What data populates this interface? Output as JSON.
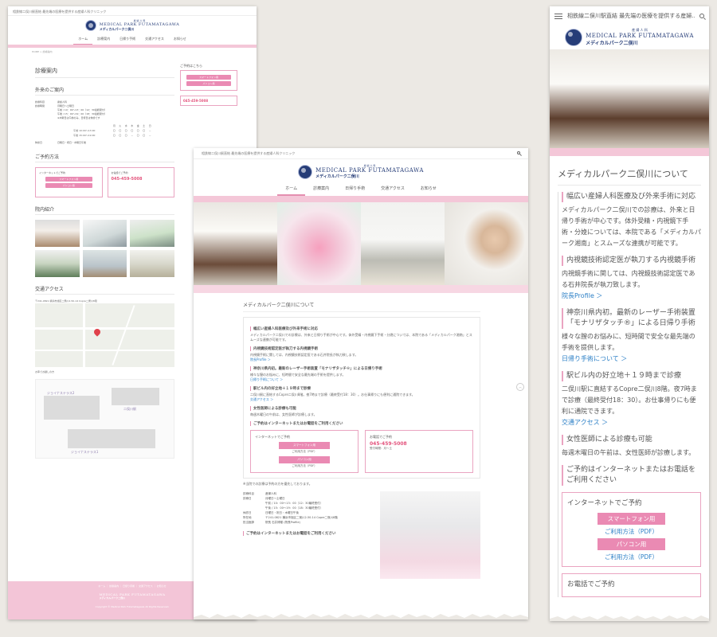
{
  "left": {
    "topbar": "相鉄線二俣川駅直結 最先端の医療を提供する産婦人科クリニック",
    "logo": {
      "kana": "産 婦 人 科",
      "en": "MEDICAL PARK FUTAMATAGAWA",
      "jp": "メディカルパーク二俣川"
    },
    "nav": [
      "ホーム",
      "診療案内",
      "日帰り手術",
      "交通アクセス",
      "お知らせ"
    ],
    "crumb": "HOME > 診療案内",
    "page_title": "診療案内",
    "outpatient_title": "外来のご案内",
    "rows": [
      {
        "k": "診療科目",
        "v": "産婦人科"
      },
      {
        "k": "診療時間",
        "v": "月曜日～土曜日"
      },
      {
        "k": "",
        "v": "午前 / 10：00～13：00（12：30最終受付）"
      },
      {
        "k": "",
        "v": "午後 / 15：00～19：00（18：30最終受付）"
      },
      {
        "k": "",
        "v": "※木曜日は午前のみ、日祝日は休診です"
      }
    ],
    "sched_head": [
      "",
      "月",
      "火",
      "水",
      "木",
      "金",
      "土",
      "日"
    ],
    "sched_am": [
      "午前 10:00～13:00",
      "〇",
      "〇",
      "〇",
      "〇",
      "〇",
      "〇",
      "－"
    ],
    "sched_pm": [
      "午後 15:00～19:00",
      "〇",
      "〇",
      "〇",
      "－",
      "〇",
      "〇",
      "－"
    ],
    "holiday": {
      "k": "休診日",
      "v": "日曜日・祝日・木曜日午後"
    },
    "reserve_title": "ご予約方法",
    "reserve_net": "インターネットでご予約",
    "btn_sp": "スマートフォン用",
    "btn_pc": "パソコン用",
    "reserve_tel": "お電話でご予約",
    "tel": "045-459-5008",
    "interior_title": "院内紹介",
    "access_title": "交通アクセス",
    "address": "〒241-0821 横浜市旭区二俣川2-50-14 Copre二俣川8階",
    "route_title": "お車でお越しの方",
    "station_labels": [
      "ジョイナステラス2",
      "ジョイナステラス1",
      "二俣川駅"
    ],
    "side_title": "ご予約はこちら",
    "footer_links": "ホーム ｜ 診療案内 ｜ 日帰り手術 ｜ 交通アクセス ｜ お知らせ",
    "copyright": "Copyright © Medical Park Futamatagawa All Rights Reserved."
  },
  "mid": {
    "topbar": "相鉄線二俣川駅直結 最先端の医療を提供する産婦人科クリニック",
    "logo": {
      "kana": "産 婦 人 科",
      "en": "MEDICAL PARK FUTAMATAGAWA",
      "jp": "メディカルパーク二俣川"
    },
    "nav": [
      "ホーム",
      "診療案内",
      "日帰り手術",
      "交通アクセス",
      "お知らせ"
    ],
    "section_title": "メディカルパーク二俣川について",
    "points": [
      {
        "t": "幅広い産婦人科医療及び外来手術に対応",
        "d": "メディカルパーク二俣川での診療は、外来と日帰り手術が中心です。体外受精・内視鏡下手術・分娩については、本院である「メディカルパーク湘南」とスムーズな連携が可能です。",
        "l": ""
      },
      {
        "t": "内視鏡技術認定医が執刀する内視鏡手術",
        "d": "内視鏡手術に関しては、内視鏡技術認定医である石井院長が執刀致します。",
        "l": "院長Profile ＞"
      },
      {
        "t": "神奈川県内初。最新のレーザー手術装置「モナリザタッチ®」による日帰り手術",
        "d": "様々な膣のお悩みに、短時間で安全な最先端の手術を提供します。",
        "l": "日帰り手術について ＞"
      },
      {
        "t": "駅ビル内の好立地＋１９時まで診療",
        "d": "二俣川駅に直結するCopre二俣川8階。夜7時まで診療（最終受付18：30）。お仕事帰りにも便利に通院できます。",
        "l": "交通アクセス ＞"
      },
      {
        "t": "女性医師による診療も可能",
        "d": "毎週木曜日の午前は、女性医師が診療します。",
        "l": ""
      }
    ],
    "reserve_title": "ご予約はインターネットまたはお電話をご利用ください",
    "net_title": "インターネットでご予約",
    "btn_sp": "スマートフォン用",
    "btn_pc": "パソコン用",
    "pdf": "ご利用方法（PDF）",
    "tel_title": "お電話でご予約",
    "tel": "045-459-5008",
    "tel_hours": "受付時間：月～土",
    "note": "※当院での診療は予約の方を優先しております。",
    "info": [
      {
        "k": "診療科目",
        "v": "産婦人科"
      },
      {
        "k": "診療日",
        "v": "月曜日～土曜日"
      },
      {
        "k": "",
        "v": "午前 / 10：00～13：00（12：30最終受付）"
      },
      {
        "k": "",
        "v": "午後 / 15：00～19：00（18：30最終受付）"
      },
      {
        "k": "休診日",
        "v": "日曜日・祝日・木曜日午後"
      },
      {
        "k": "所在地",
        "v": "〒241-0821 横浜市旭区二俣川2-50-14 Copre二俣川8階"
      },
      {
        "k": "担当医師",
        "v": "院長 石井博樹 (院長Profile)"
      }
    ],
    "bottom_title": "ご予約はインターネットまたはお電話をご利用ください"
  },
  "right": {
    "title": "相鉄線二俣川駅直結 最先端の医療を提供する産婦…",
    "logo": {
      "kana": "産 婦 人 科",
      "en": "MEDICAL PARK FUTAMATAGAWA",
      "jp": "メディカルパーク二俣川"
    },
    "section_title": "メディカルパーク二俣川について",
    "points": [
      {
        "t": "幅広い産婦人科医療及び外来手術に対応",
        "d": "メディカルパーク二俣川での診療は、外来と日帰り手術が中心です。体外受精・内視鏡下手術・分娩については、本院である「メディカルパーク湘南」とスムーズな連携が可能です。",
        "l": ""
      },
      {
        "t": "内視鏡技術認定医が執刀する内視鏡手術",
        "d": "内視鏡手術に関しては、内視鏡技術認定医である石井院長が執刀致します。",
        "l": "院長Profile ＞"
      },
      {
        "t": "神奈川県内初。最新のレーザー手術装置「モナリザタッチ®」による日帰り手術",
        "d": "様々な膣のお悩みに、短時間で安全な最先端の手術を提供します。",
        "l": "日帰り手術について ＞"
      },
      {
        "t": "駅ビル内の好立地＋１９時まで診療",
        "d": "二俣川駅に直結するCopre二俣川8階。夜7時まで診療（最終受付18：30）。お仕事帰りにも便利に通院できます。",
        "l": "交通アクセス ＞"
      },
      {
        "t": "女性医師による診療も可能",
        "d": "毎週木曜日の午前は、女性医師が診療します。",
        "l": ""
      }
    ],
    "reserve_title": "ご予約はインターネットまたはお電話をご利用ください",
    "net_title": "インターネットでご予約",
    "btn_sp": "スマートフォン用",
    "btn_pc": "パソコン用",
    "pdf": "ご利用方法（PDF）",
    "tel_title": "お電話でご予約"
  }
}
